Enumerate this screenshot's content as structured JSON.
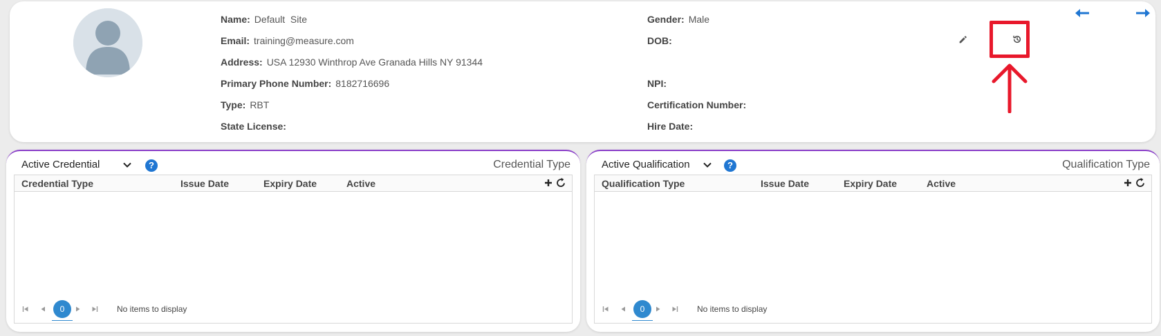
{
  "profile": {
    "left_fields": [
      {
        "label": "Name:",
        "value": "Default  Site"
      },
      {
        "label": "Email:",
        "value": "training@measure.com"
      },
      {
        "label": "Address:",
        "value": "USA 12930 Winthrop Ave Granada Hills NY 91344"
      },
      {
        "label": "Primary Phone Number:",
        "value": "8182716696"
      },
      {
        "label": "Type:",
        "value": "RBT"
      },
      {
        "label": "State License:",
        "value": ""
      }
    ],
    "right_fields": [
      {
        "label": "Gender:",
        "value": "Male"
      },
      {
        "label": "DOB:",
        "value": ""
      },
      {
        "label": "NPI:",
        "value": ""
      },
      {
        "label": "Certification Number:",
        "value": ""
      },
      {
        "label": "Hire Date:",
        "value": ""
      }
    ],
    "icons": [
      "avatar-icon",
      "pencil-icon",
      "history-icon",
      "arrow-left-icon",
      "arrow-right-icon"
    ],
    "annotation_color": "#e8182b"
  },
  "credential_panel": {
    "select_label": "Active Credential",
    "type_title": "Credential Type",
    "columns": [
      "Credential Type",
      "Issue Date",
      "Expiry Date",
      "Active"
    ],
    "page_number": "0",
    "pager_info": "No items to display"
  },
  "qualification_panel": {
    "select_label": "Active Qualification",
    "type_title": "Qualification Type",
    "columns": [
      "Qualification Type",
      "Issue Date",
      "Expiry Date",
      "Active"
    ],
    "page_number": "0",
    "pager_info": "No items to display"
  },
  "colors": {
    "accent": "#1f76d2",
    "panel_border": "#8a3ec9",
    "pager_active": "#2f89cf",
    "annotation": "#e8182b"
  }
}
